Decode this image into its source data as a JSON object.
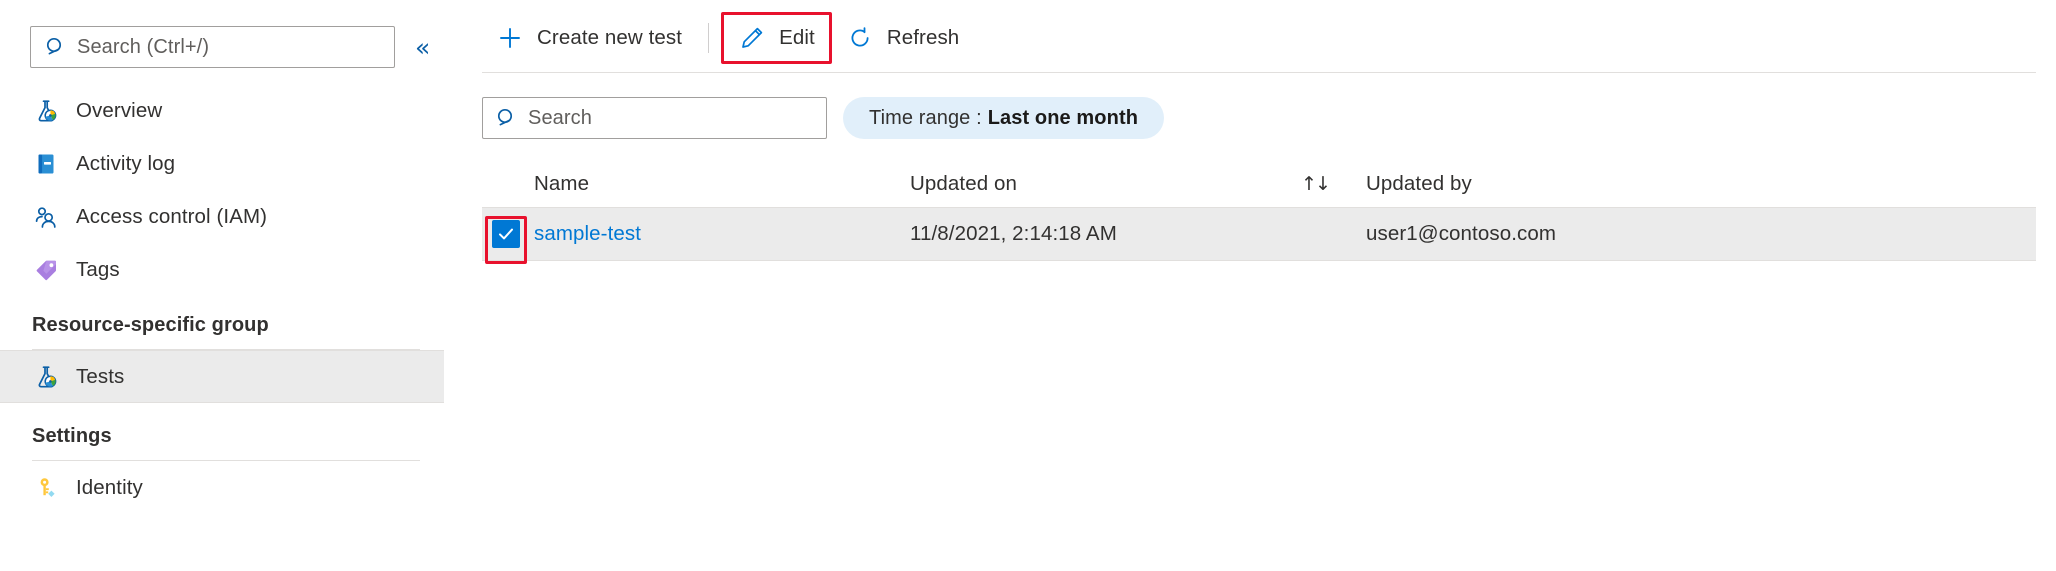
{
  "sidebar": {
    "search": {
      "placeholder": "Search (Ctrl+/)",
      "icon": "search-icon"
    },
    "collapse": {
      "label": "«",
      "icon": "chevron-double-left-icon"
    },
    "items": [
      {
        "label": "Overview",
        "icon": "flask-gauge-icon",
        "selected": false
      },
      {
        "label": "Activity log",
        "icon": "book-icon",
        "selected": false
      },
      {
        "label": "Access control (IAM)",
        "icon": "people-icon",
        "selected": false
      },
      {
        "label": "Tags",
        "icon": "tag-icon",
        "selected": false
      }
    ],
    "groups": [
      {
        "title": "Resource-specific group",
        "items": [
          {
            "label": "Tests",
            "icon": "flask-gauge-icon",
            "selected": true
          }
        ]
      },
      {
        "title": "Settings",
        "items": [
          {
            "label": "Identity",
            "icon": "key-icon",
            "selected": false
          }
        ]
      }
    ]
  },
  "toolbar": {
    "buttons": [
      {
        "label": "Create new test",
        "icon": "plus-icon",
        "highlighted": false
      },
      {
        "label": "Edit",
        "icon": "pencil-icon",
        "highlighted": true
      },
      {
        "label": "Refresh",
        "icon": "refresh-circle-icon",
        "highlighted": false
      }
    ]
  },
  "filters": {
    "search": {
      "placeholder": "Search",
      "value": "",
      "icon": "search-icon"
    },
    "time_range": {
      "label": "Time range :",
      "value": "Last one month"
    }
  },
  "table": {
    "columns": {
      "name": "Name",
      "updated_on": "Updated on",
      "updated_by": "Updated by",
      "sort_glyph": "↑↓"
    },
    "rows": [
      {
        "checked": true,
        "name": "sample-test",
        "updated_on": "11/8/2021, 2:14:18 AM",
        "updated_by": "user1@contoso.com"
      }
    ]
  },
  "colors": {
    "accent": "#0078d4",
    "highlight_box": "#e8112d",
    "selected_row": "#ebebeb",
    "pill_bg": "#e1effa",
    "link": "#0078d4"
  }
}
